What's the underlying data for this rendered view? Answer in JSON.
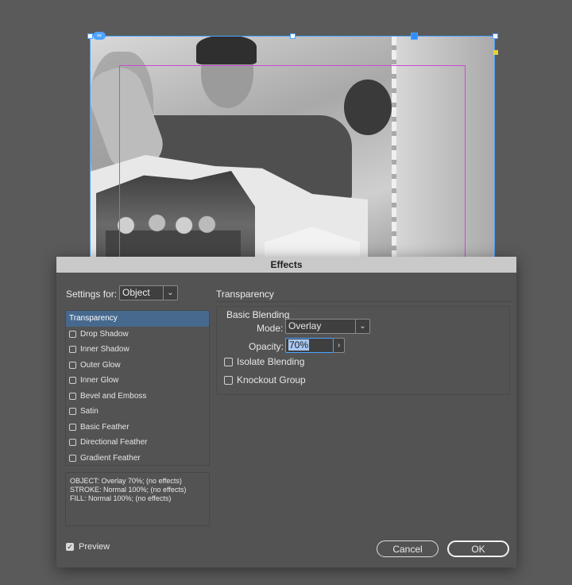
{
  "dialog": {
    "title": "Effects",
    "settings_label": "Settings for:",
    "settings_value": "Object",
    "effects": [
      {
        "label": "Transparency",
        "selected": true,
        "checkbox": false
      },
      {
        "label": "Drop Shadow",
        "selected": false,
        "checkbox": true
      },
      {
        "label": "Inner Shadow",
        "selected": false,
        "checkbox": true
      },
      {
        "label": "Outer Glow",
        "selected": false,
        "checkbox": true
      },
      {
        "label": "Inner Glow",
        "selected": false,
        "checkbox": true
      },
      {
        "label": "Bevel and Emboss",
        "selected": false,
        "checkbox": true
      },
      {
        "label": "Satin",
        "selected": false,
        "checkbox": true
      },
      {
        "label": "Basic Feather",
        "selected": false,
        "checkbox": true
      },
      {
        "label": "Directional Feather",
        "selected": false,
        "checkbox": true
      },
      {
        "label": "Gradient Feather",
        "selected": false,
        "checkbox": true
      }
    ],
    "summary": [
      "OBJECT: Overlay 70%; (no effects)",
      "STROKE: Normal 100%; (no effects)",
      "FILL: Normal 100%; (no effects)"
    ],
    "preview_label": "Preview",
    "preview_checked": true,
    "section_title": "Transparency",
    "basic_blending_title": "Basic Blending",
    "mode_label": "Mode:",
    "mode_value": "Overlay",
    "opacity_label": "Opacity:",
    "opacity_value": "70%",
    "isolate_label": "Isolate Blending",
    "knockout_label": "Knockout Group",
    "cancel_label": "Cancel",
    "ok_label": "OK"
  },
  "colors": {
    "accent": "#4da3ff",
    "selection": "#47698e",
    "guide": "#c94bd1"
  }
}
